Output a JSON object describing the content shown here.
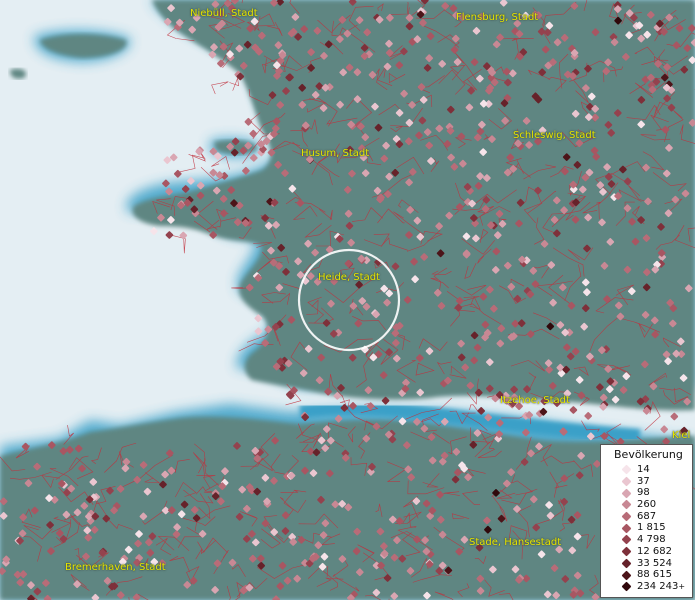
{
  "map": {
    "cities": [
      {
        "name": "Niebüll, Stadt"
      },
      {
        "name": "Flensburg, Stadt"
      },
      {
        "name": "Schleswig, Stadt"
      },
      {
        "name": "Husum, Stadt"
      },
      {
        "name": "Heide, Stadt"
      },
      {
        "name": "Itzehoe, Stadt"
      },
      {
        "name": "Stade, Hansestadt"
      },
      {
        "name": "Bremerhaven, Stadt"
      },
      {
        "name": "Kiel"
      }
    ],
    "colors": {
      "land": "#5f8682",
      "water": "#e4eef3",
      "coast_glow": "#3aa0c8",
      "boundaries": "#c0303c",
      "label": "#e6e600",
      "highlight_circle": "#ffffff"
    }
  },
  "legend": {
    "title": "Bevölkerung",
    "items": [
      {
        "label": "14",
        "color": "#f6e4ea"
      },
      {
        "label": "37",
        "color": "#eac6d0"
      },
      {
        "label": "98",
        "color": "#d9a6b2"
      },
      {
        "label": "260",
        "color": "#c88894"
      },
      {
        "label": "687",
        "color": "#b86c78"
      },
      {
        "label": "1 815",
        "color": "#a85662"
      },
      {
        "label": "4 798",
        "color": "#94424e"
      },
      {
        "label": "12 682",
        "color": "#7e303a"
      },
      {
        "label": "33 524",
        "color": "#66222a"
      },
      {
        "label": "88 615",
        "color": "#4c1419"
      },
      {
        "label": "234 243",
        "color": "#30080b",
        "suffix": "+"
      }
    ]
  }
}
